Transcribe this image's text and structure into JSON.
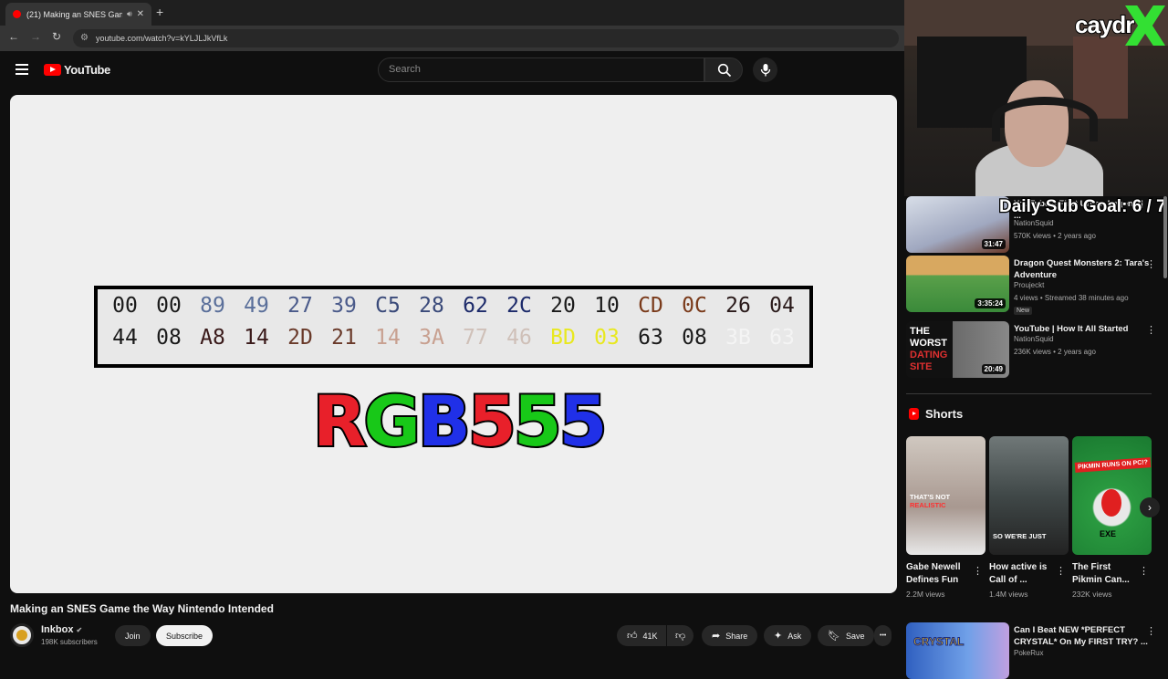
{
  "browser": {
    "tab_title": "(21) Making an SNES Game",
    "new_tab": "+",
    "close": "✕",
    "url": "youtube.com/watch?v=kYLJLJkVfLk"
  },
  "header": {
    "logo_text": "YouTube",
    "search_placeholder": "Search"
  },
  "video": {
    "hex_rows": [
      [
        {
          "v": "00",
          "c": "#1a1a1a"
        },
        {
          "v": "00",
          "c": "#1a1a1a"
        },
        {
          "v": "89",
          "c": "#5a6f9a"
        },
        {
          "v": "49",
          "c": "#5a6f9a"
        },
        {
          "v": "27",
          "c": "#4a5a8a"
        },
        {
          "v": "39",
          "c": "#4a5a8a"
        },
        {
          "v": "C5",
          "c": "#3a4a7a"
        },
        {
          "v": "28",
          "c": "#3a4a7a"
        },
        {
          "v": "62",
          "c": "#1c2a6a"
        },
        {
          "v": "2C",
          "c": "#1c2a6a"
        },
        {
          "v": "20",
          "c": "#1a1a1a"
        },
        {
          "v": "10",
          "c": "#1a1a1a"
        },
        {
          "v": "CD",
          "c": "#7a3a1a"
        },
        {
          "v": "0C",
          "c": "#7a3a1a"
        },
        {
          "v": "26",
          "c": "#2a1a1a"
        },
        {
          "v": "04",
          "c": "#2a1a1a"
        }
      ],
      [
        {
          "v": "44",
          "c": "#1a1a1a"
        },
        {
          "v": "08",
          "c": "#1a1a1a"
        },
        {
          "v": "A8",
          "c": "#3a1a1a"
        },
        {
          "v": "14",
          "c": "#3a1a1a"
        },
        {
          "v": "2D",
          "c": "#6a3a2a"
        },
        {
          "v": "21",
          "c": "#6a3a2a"
        },
        {
          "v": "14",
          "c": "#c8a090"
        },
        {
          "v": "3A",
          "c": "#c8a090"
        },
        {
          "v": "77",
          "c": "#cfc0b8"
        },
        {
          "v": "46",
          "c": "#cfc0b8"
        },
        {
          "v": "BD",
          "c": "#e8e820"
        },
        {
          "v": "03",
          "c": "#e8e820"
        },
        {
          "v": "63",
          "c": "#1a1a1a"
        },
        {
          "v": "08",
          "c": "#1a1a1a"
        },
        {
          "v": "3B",
          "c": "#f4f4f4"
        },
        {
          "v": "63",
          "c": "#f4f4f4"
        }
      ]
    ],
    "rgb_letters": [
      {
        "t": "R",
        "c": "#e8202a"
      },
      {
        "t": "G",
        "c": "#18c818"
      },
      {
        "t": "B",
        "c": "#2030e8"
      },
      {
        "t": "5",
        "c": "#e8202a"
      },
      {
        "t": "5",
        "c": "#18c818"
      },
      {
        "t": "5",
        "c": "#2030e8"
      }
    ],
    "title": "Making an SNES Game the Way Nintendo Intended",
    "channel": "Inkbox",
    "verified": "✔",
    "subscribers": "198K subscribers",
    "join": "Join",
    "subscribe": "Subscribe",
    "likes": "41K",
    "share": "Share",
    "ask": "Ask",
    "save": "Save",
    "more": "•••"
  },
  "overlay": {
    "streamer": "caydr",
    "sub_goal": "Daily Sub Goal:  6 / 7"
  },
  "recs": [
    {
      "title": "YouTube's First Urban Legend | ...",
      "channel": "NationSquid",
      "meta": "570K views • 2 years ago",
      "duration": "31:47",
      "bg": "#c0c8d8"
    },
    {
      "title": "Dragon Quest Monsters 2: Tara's Adventure",
      "channel": "Proujeckt",
      "meta": "4 views • Streamed 38 minutes ago",
      "duration": "3:35:24",
      "badge": "New",
      "bg": "#5aa04a"
    },
    {
      "title": "YouTube | How It All Started",
      "channel": "NationSquid",
      "meta": "236K views • 2 years ago",
      "duration": "20:49",
      "bg": "#1a1a1a"
    },
    {
      "title": "Can I Beat NEW *PERFECT CRYSTAL* On My FIRST TRY? ...",
      "channel": "PokeRux",
      "meta": "",
      "duration": "",
      "bg": "#3060c0"
    }
  ],
  "shorts": {
    "heading": "Shorts",
    "items": [
      {
        "title": "Gabe Newell Defines Fun",
        "views": "2.2M views",
        "bg": "#b8a8a0",
        "cap": "THAT'S NOT ",
        "cap2": "REALISTIC"
      },
      {
        "title": "How active is Call of ...",
        "views": "1.4M views",
        "bg": "#505858",
        "cap": "SO WE'RE JUST",
        "cap2": ""
      },
      {
        "title": "The First Pikmin Can...",
        "views": "232K views",
        "bg": "#2a9a40",
        "cap": "PIKMIN RUNS ON PC!?",
        "cap2": "EXE"
      }
    ]
  }
}
